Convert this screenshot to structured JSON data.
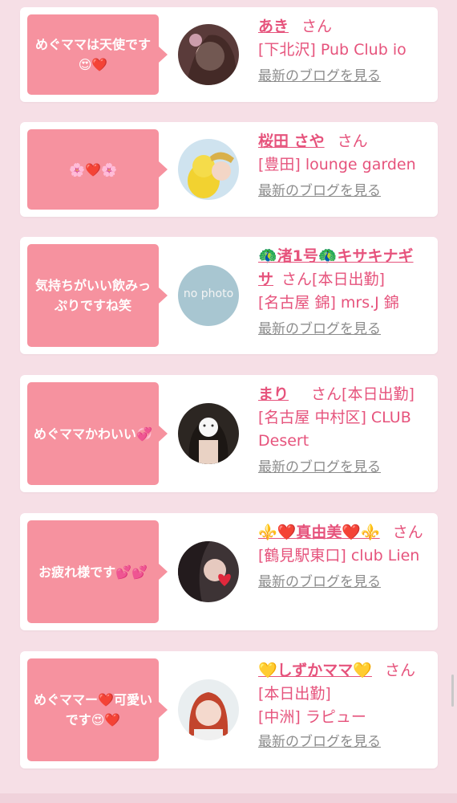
{
  "comments": [
    {
      "message": "めぐママは天使です😍❤️",
      "name": "あき",
      "san": "さん",
      "status": "",
      "shop": "[下北沢] Pub Club io",
      "blog": "最新のブログを見る"
    },
    {
      "message": "🌸❤️🌸",
      "name": "桜田 さや",
      "san": "さん",
      "status": "",
      "shop": "[豊田] lounge garden",
      "blog": "最新のブログを見る"
    },
    {
      "message": "気持ちがいい飲みっぷりですね笑",
      "name": "🦚渚1号🦚キサキナギサ",
      "san": "さん",
      "status": "[本日出勤]",
      "shop": "[名古屋 錦] mrs.J 錦",
      "blog": "最新のブログを見る",
      "avatar_text": "no photo"
    },
    {
      "message": "めぐママかわいい💞",
      "name": "まり",
      "san": "さん",
      "status": "[本日出勤]",
      "shop": "[名古屋 中村区] CLUB Desert",
      "blog": "最新のブログを見る"
    },
    {
      "message": "お疲れ様です💕💕",
      "name": "⚜️❤️真由美❤️⚜️",
      "san": "さん",
      "status": "",
      "shop": "[鶴見駅東口] club Lien",
      "blog": "最新のブログを見る"
    },
    {
      "message": "めぐママー❤️可愛いです😍❤️",
      "name": "💛しずかママ💛",
      "san": "さん",
      "status": "[本日出勤]",
      "shop": "[中洲] ラピュー",
      "blog": "最新のブログを見る"
    }
  ],
  "colors": {
    "bubble": "#f6929f",
    "accent": "#e6537c",
    "link_gray": "#8c8c8c",
    "background": "#f6dfe6"
  }
}
